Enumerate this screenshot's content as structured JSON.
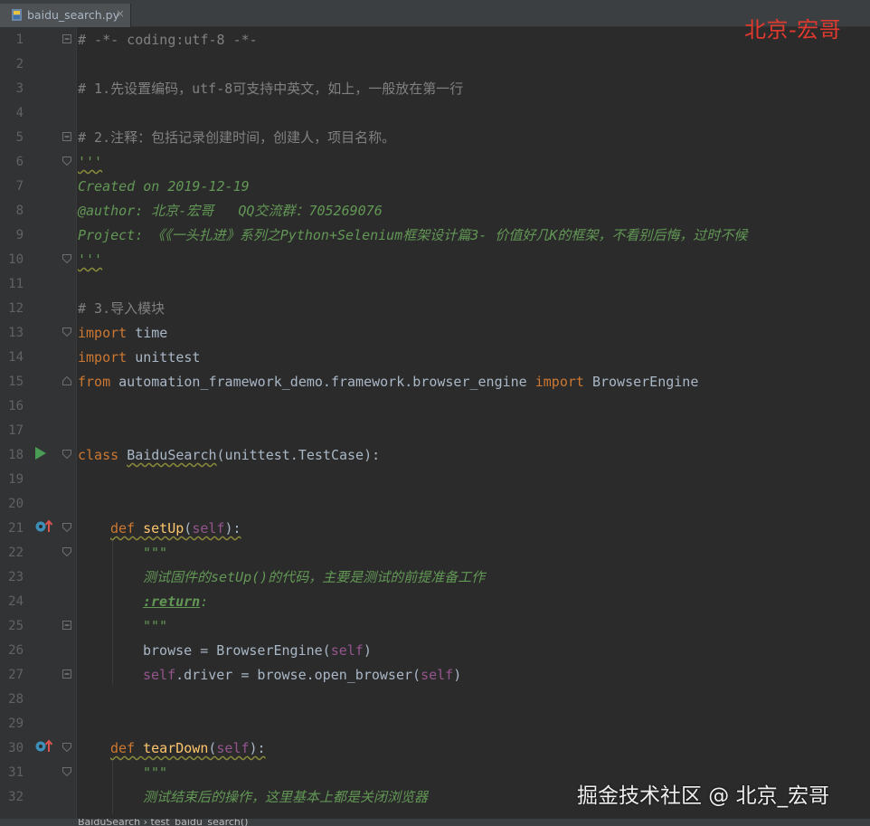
{
  "tab": {
    "filename": "baidu_search.py",
    "close": "×"
  },
  "watermark_top": "北京-宏哥",
  "watermark_bottom": "掘金技术社区 @ 北京_宏哥",
  "breadcrumb": "BaiduSearch  ›  test_baidu_search()",
  "line_numbers": [
    "1",
    "2",
    "3",
    "4",
    "5",
    "6",
    "7",
    "8",
    "9",
    "10",
    "11",
    "12",
    "13",
    "14",
    "15",
    "16",
    "17",
    "18",
    "19",
    "20",
    "21",
    "22",
    "23",
    "24",
    "25",
    "26",
    "27",
    "28",
    "29",
    "30",
    "31",
    "32"
  ],
  "code": {
    "l1": "# -*- coding:utf-8 -*-",
    "l3": "# 1.先设置编码，utf-8可支持中英文，如上，一般放在第一行",
    "l5": "# 2.注释：包括记录创建时间，创建人，项目名称。",
    "l6": "'''",
    "l7": "Created on 2019-12-19",
    "l8": "@author: 北京-宏哥   QQ交流群：705269076",
    "l9": "Project: 《《一头扎进》系列之Python+Selenium框架设计篇3- 价值好几K的框架，不看别后悔，过时不候",
    "l10": "'''",
    "l12": "# 3.导入模块",
    "l13_kw": "import",
    "l13_rest": " time",
    "l14_kw": "import",
    "l14_rest": " unittest",
    "l15_kw1": "from",
    "l15_mid": " automation_framework_demo.framework.browser_engine ",
    "l15_kw2": "import",
    "l15_rest": " BrowserEngine",
    "l18_kw": "class",
    "l18_name": "BaiduSearch",
    "l18_rest": "(unittest.TestCase):",
    "l21_kw": "def",
    "l21_name": "setUp",
    "l21_self": "self",
    "l21_end": "):",
    "l22": "\"\"\"",
    "l23": "测试固件的setUp()的代码，主要是测试的前提准备工作",
    "l24_tag": ":return",
    "l24_end": ":",
    "l25": "\"\"\"",
    "l26_a": "browse = BrowserEngine(",
    "l26_self": "self",
    "l26_b": ")",
    "l27_self1": "self",
    "l27_a": ".driver = browse.open_browser(",
    "l27_self2": "self",
    "l27_b": ")",
    "l30_kw": "def",
    "l30_name": "tearDown",
    "l30_self": "self",
    "l30_end": "):",
    "l31": "\"\"\"",
    "l32": "测试结束后的操作，这里基本上都是关闭浏览器"
  },
  "colors": {
    "background": "#2b2b2b",
    "keyword": "#cc7832",
    "comment": "#808080",
    "docstring": "#629755",
    "self": "#94558d",
    "function": "#ffc66d",
    "text": "#a9b7c6"
  },
  "icons": [
    "python-file-icon",
    "run-arrow-icon",
    "override-method-icon",
    "fold-icon"
  ]
}
